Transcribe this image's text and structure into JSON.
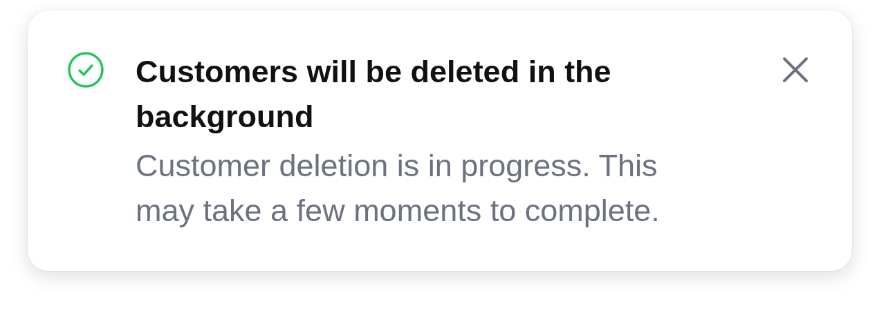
{
  "toast": {
    "kind": "success",
    "title": "Customers will be deleted in the background",
    "message": "Customer deletion is in progress. This may take a few moments to complete."
  }
}
